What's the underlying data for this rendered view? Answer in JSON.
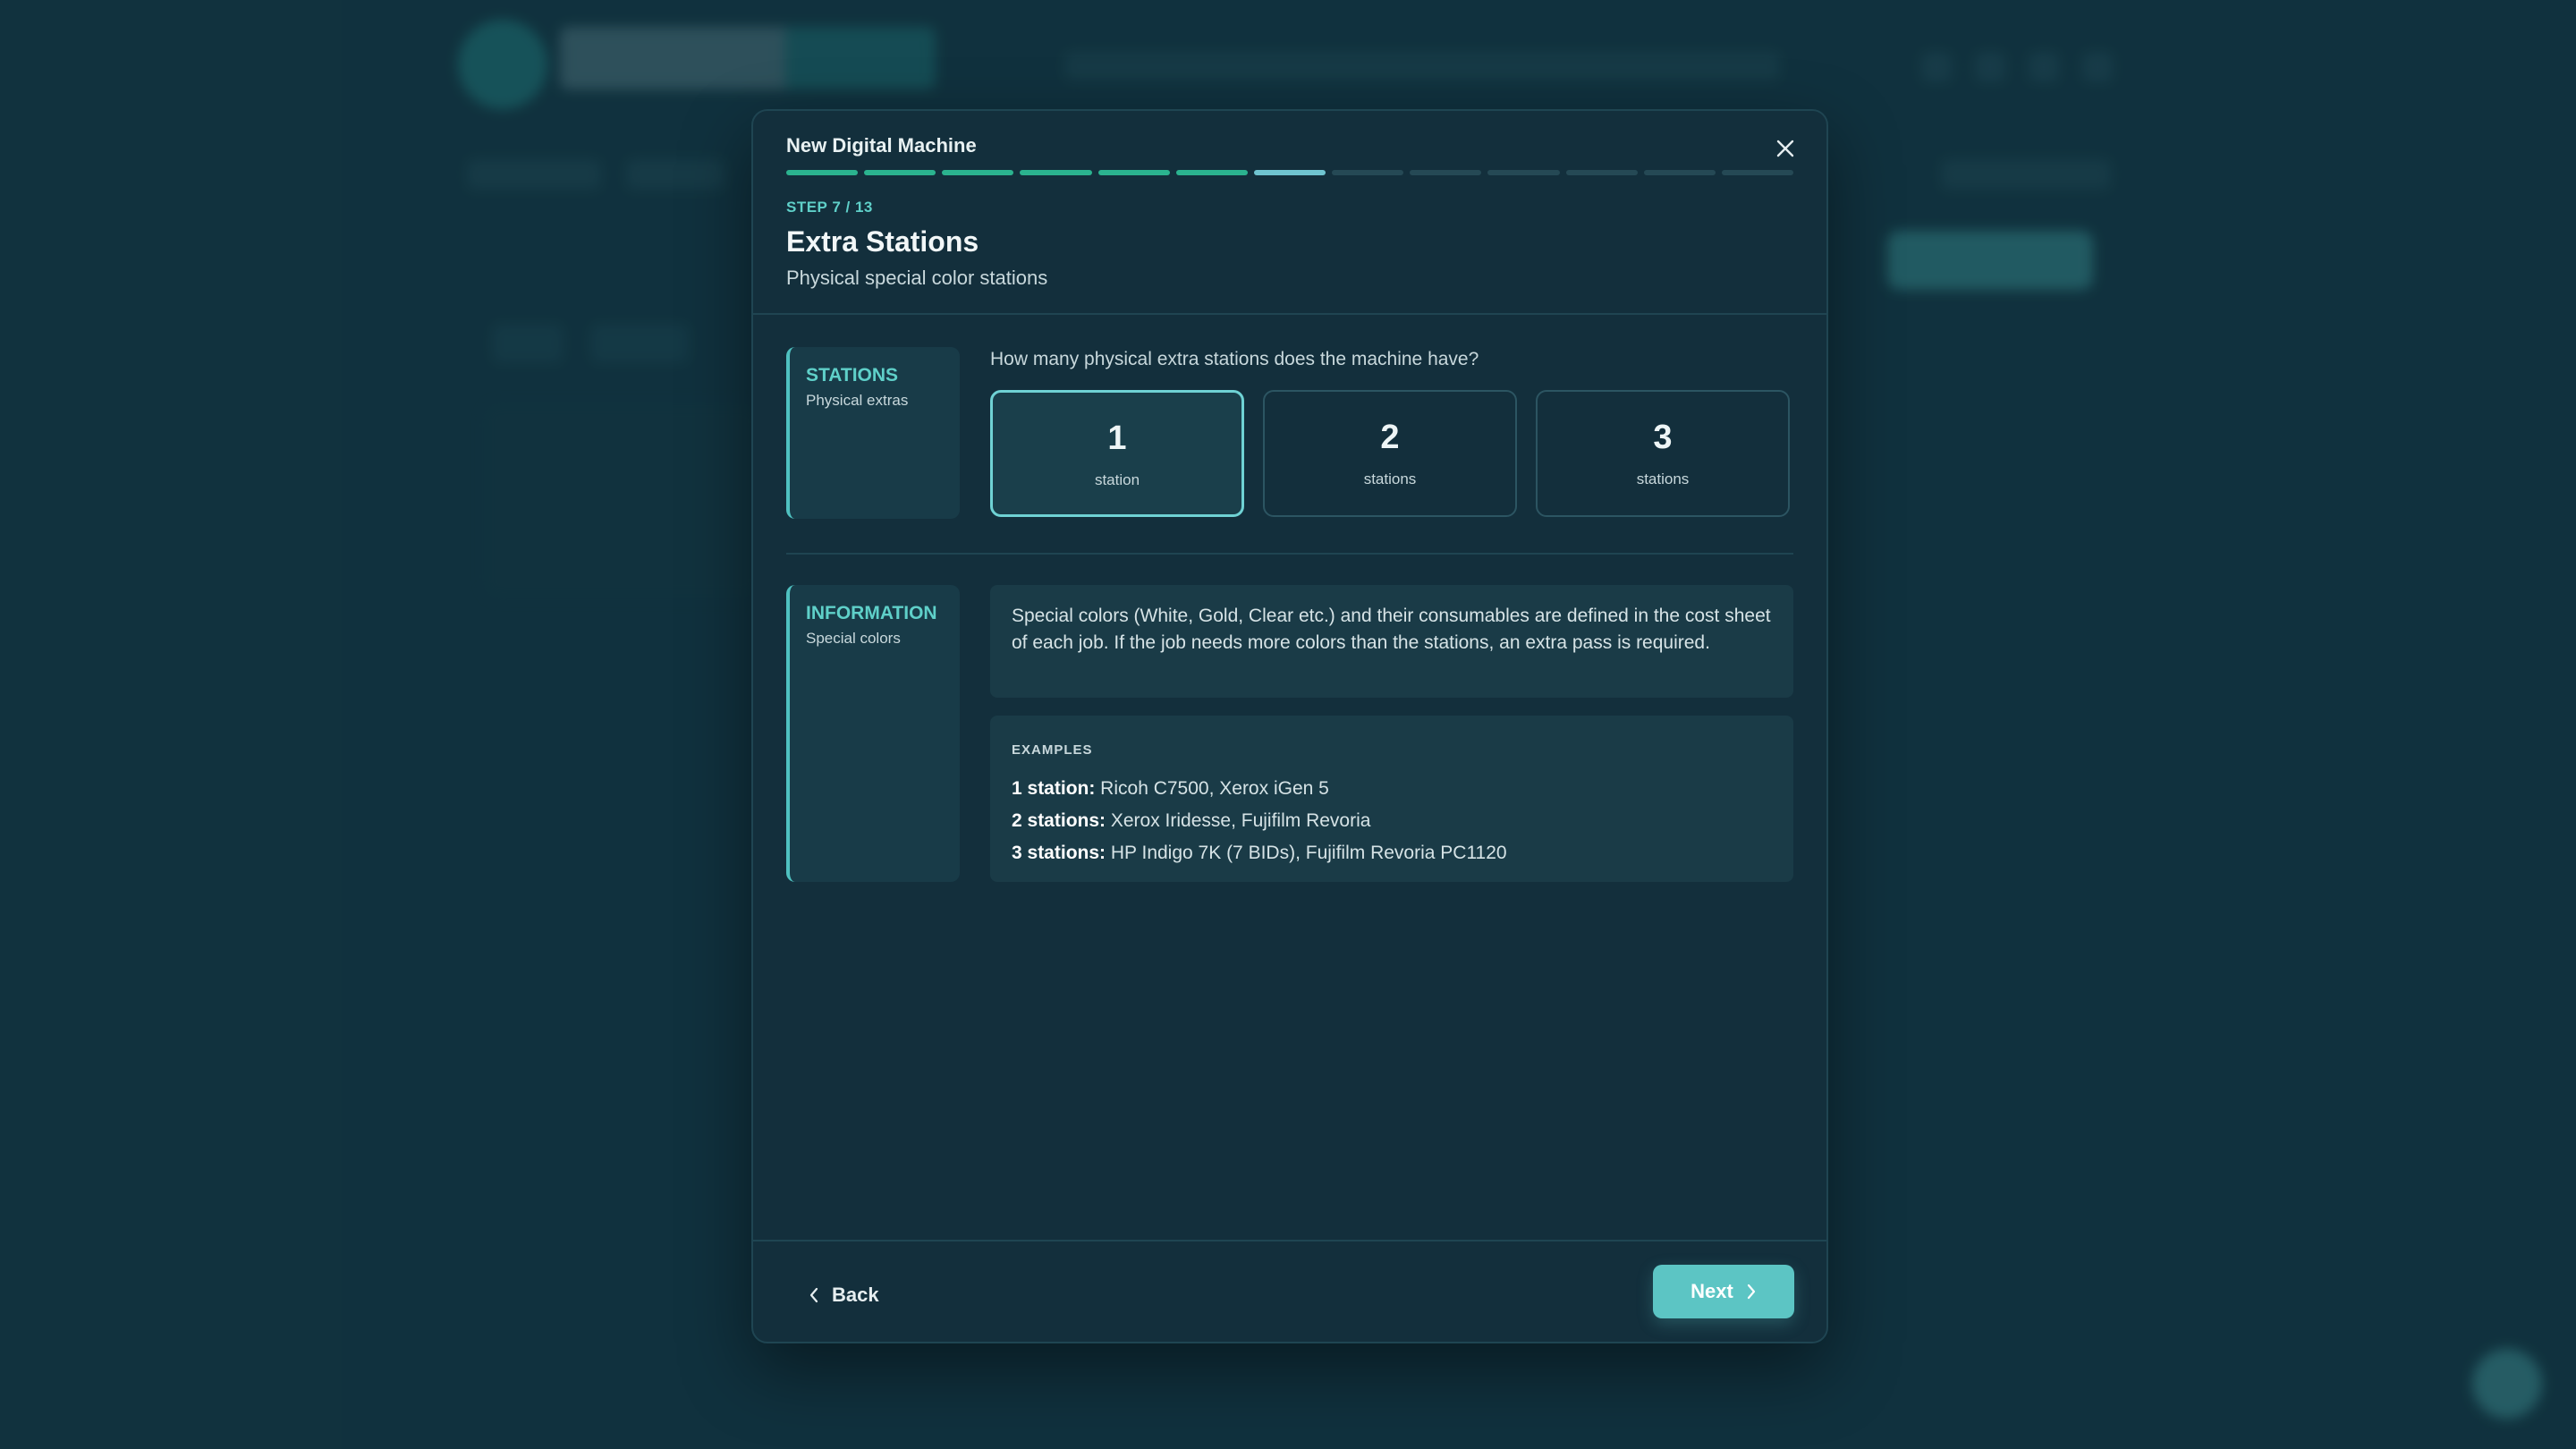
{
  "modal": {
    "title": "New Digital Machine",
    "progress": {
      "current_step": 7,
      "total_steps": 13
    },
    "step_label": "STEP 7 / 13",
    "section_title": "Extra Stations",
    "section_subtitle": "Physical special color stations"
  },
  "stations": {
    "label": "STATIONS",
    "sublabel": "Physical extras",
    "question": "How many physical extra stations does the machine have?",
    "options": [
      {
        "value": "1",
        "unit": "station",
        "selected": true
      },
      {
        "value": "2",
        "unit": "stations",
        "selected": false
      },
      {
        "value": "3",
        "unit": "stations",
        "selected": false
      }
    ]
  },
  "information": {
    "label": "INFORMATION",
    "sublabel": "Special colors",
    "text": "Special colors (White, Gold, Clear etc.) and their consumables are defined in the cost sheet of each job. If the job needs more colors than the stations, an extra pass is required.",
    "examples_heading": "EXAMPLES",
    "examples": [
      {
        "key": "1 station:",
        "value": " Ricoh C7500, Xerox iGen 5"
      },
      {
        "key": "2 stations:",
        "value": " Xerox Iridesse, Fujifilm Revoria"
      },
      {
        "key": "3 stations:",
        "value": " HP Indigo 7K (7 BIDs), Fujifilm Revoria PC1120"
      }
    ]
  },
  "footer": {
    "back_label": "Back",
    "next_label": "Next"
  },
  "colors": {
    "accent": "#5cc5c4",
    "progress_done": "#2bb38f",
    "progress_current": "#6fc4d0",
    "background": "#153a47"
  },
  "icons": {
    "close": "close-icon",
    "back": "chevron-left-icon",
    "next": "chevron-right-icon"
  }
}
